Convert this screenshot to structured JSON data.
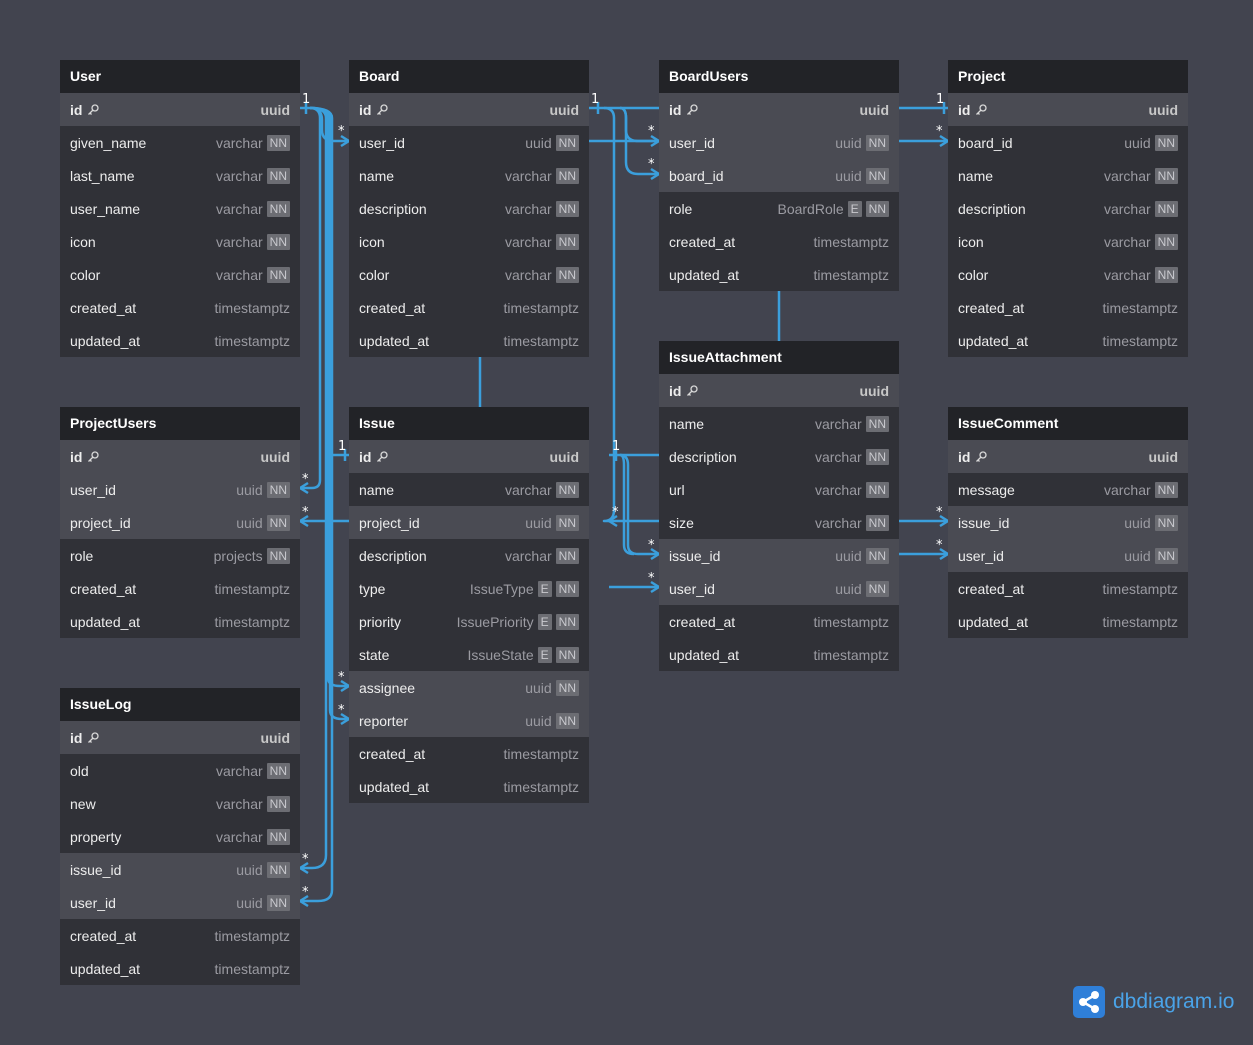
{
  "tables": [
    {
      "name": "User",
      "fields": [
        {
          "name": "id",
          "type": "uuid",
          "pk": true
        },
        {
          "name": "given_name",
          "type": "varchar",
          "nn": true
        },
        {
          "name": "last_name",
          "type": "varchar",
          "nn": true
        },
        {
          "name": "user_name",
          "type": "varchar",
          "nn": true
        },
        {
          "name": "icon",
          "type": "varchar",
          "nn": true
        },
        {
          "name": "color",
          "type": "varchar",
          "nn": true
        },
        {
          "name": "created_at",
          "type": "timestamptz"
        },
        {
          "name": "updated_at",
          "type": "timestamptz"
        }
      ]
    },
    {
      "name": "Board",
      "fields": [
        {
          "name": "id",
          "type": "uuid",
          "pk": true
        },
        {
          "name": "user_id",
          "type": "uuid",
          "nn": true
        },
        {
          "name": "name",
          "type": "varchar",
          "nn": true
        },
        {
          "name": "description",
          "type": "varchar",
          "nn": true
        },
        {
          "name": "icon",
          "type": "varchar",
          "nn": true
        },
        {
          "name": "color",
          "type": "varchar",
          "nn": true
        },
        {
          "name": "created_at",
          "type": "timestamptz"
        },
        {
          "name": "updated_at",
          "type": "timestamptz"
        }
      ]
    },
    {
      "name": "BoardUsers",
      "fields": [
        {
          "name": "id",
          "type": "uuid",
          "pk": true
        },
        {
          "name": "user_id",
          "type": "uuid",
          "nn": true,
          "link": true
        },
        {
          "name": "board_id",
          "type": "uuid",
          "nn": true,
          "link": true
        },
        {
          "name": "role",
          "type": "BoardRole",
          "enum": true,
          "nn": true
        },
        {
          "name": "created_at",
          "type": "timestamptz"
        },
        {
          "name": "updated_at",
          "type": "timestamptz"
        }
      ]
    },
    {
      "name": "Project",
      "fields": [
        {
          "name": "id",
          "type": "uuid",
          "pk": true
        },
        {
          "name": "board_id",
          "type": "uuid",
          "nn": true
        },
        {
          "name": "name",
          "type": "varchar",
          "nn": true
        },
        {
          "name": "description",
          "type": "varchar",
          "nn": true
        },
        {
          "name": "icon",
          "type": "varchar",
          "nn": true
        },
        {
          "name": "color",
          "type": "varchar",
          "nn": true
        },
        {
          "name": "created_at",
          "type": "timestamptz"
        },
        {
          "name": "updated_at",
          "type": "timestamptz"
        }
      ]
    },
    {
      "name": "ProjectUsers",
      "fields": [
        {
          "name": "id",
          "type": "uuid",
          "pk": true
        },
        {
          "name": "user_id",
          "type": "uuid",
          "nn": true,
          "link": true
        },
        {
          "name": "project_id",
          "type": "uuid",
          "nn": true,
          "link": true
        },
        {
          "name": "role",
          "type": "projects",
          "nn": true
        },
        {
          "name": "created_at",
          "type": "timestamptz"
        },
        {
          "name": "updated_at",
          "type": "timestamptz"
        }
      ]
    },
    {
      "name": "Issue",
      "fields": [
        {
          "name": "id",
          "type": "uuid",
          "pk": true
        },
        {
          "name": "name",
          "type": "varchar",
          "nn": true
        },
        {
          "name": "project_id",
          "type": "uuid",
          "nn": true,
          "link": true
        },
        {
          "name": "description",
          "type": "varchar",
          "nn": true
        },
        {
          "name": "type",
          "type": "IssueType",
          "enum": true,
          "nn": true
        },
        {
          "name": "priority",
          "type": "IssuePriority",
          "enum": true,
          "nn": true
        },
        {
          "name": "state",
          "type": "IssueState",
          "enum": true,
          "nn": true
        },
        {
          "name": "assignee",
          "type": "uuid",
          "nn": true,
          "link": true
        },
        {
          "name": "reporter",
          "type": "uuid",
          "nn": true,
          "link": true
        },
        {
          "name": "created_at",
          "type": "timestamptz"
        },
        {
          "name": "updated_at",
          "type": "timestamptz"
        }
      ]
    },
    {
      "name": "IssueAttachment",
      "fields": [
        {
          "name": "id",
          "type": "uuid",
          "pk": true
        },
        {
          "name": "name",
          "type": "varchar",
          "nn": true
        },
        {
          "name": "description",
          "type": "varchar",
          "nn": true
        },
        {
          "name": "url",
          "type": "varchar",
          "nn": true
        },
        {
          "name": "size",
          "type": "varchar",
          "nn": true
        },
        {
          "name": "issue_id",
          "type": "uuid",
          "nn": true,
          "link": true
        },
        {
          "name": "user_id",
          "type": "uuid",
          "nn": true,
          "link": true
        },
        {
          "name": "created_at",
          "type": "timestamptz"
        },
        {
          "name": "updated_at",
          "type": "timestamptz"
        }
      ]
    },
    {
      "name": "IssueComment",
      "fields": [
        {
          "name": "id",
          "type": "uuid",
          "pk": true
        },
        {
          "name": "message",
          "type": "varchar",
          "nn": true
        },
        {
          "name": "issue_id",
          "type": "uuid",
          "nn": true,
          "link": true
        },
        {
          "name": "user_id",
          "type": "uuid",
          "nn": true,
          "link": true
        },
        {
          "name": "created_at",
          "type": "timestamptz"
        },
        {
          "name": "updated_at",
          "type": "timestamptz"
        }
      ]
    },
    {
      "name": "IssueLog",
      "fields": [
        {
          "name": "id",
          "type": "uuid",
          "pk": true
        },
        {
          "name": "old",
          "type": "varchar",
          "nn": true
        },
        {
          "name": "new",
          "type": "varchar",
          "nn": true
        },
        {
          "name": "property",
          "type": "varchar",
          "nn": true
        },
        {
          "name": "issue_id",
          "type": "uuid",
          "nn": true,
          "link": true
        },
        {
          "name": "user_id",
          "type": "uuid",
          "nn": true,
          "link": true
        },
        {
          "name": "created_at",
          "type": "timestamptz"
        },
        {
          "name": "updated_at",
          "type": "timestamptz"
        }
      ]
    }
  ],
  "badges": {
    "nn": "NN",
    "enum": "E"
  },
  "cardinality": {
    "one": "1",
    "many": "*"
  },
  "brand": {
    "name": "dbdiagram",
    "suffix": ".io"
  },
  "colors": {
    "connector": "#3b9fdc",
    "background": "#42444f",
    "header": "#222327"
  }
}
